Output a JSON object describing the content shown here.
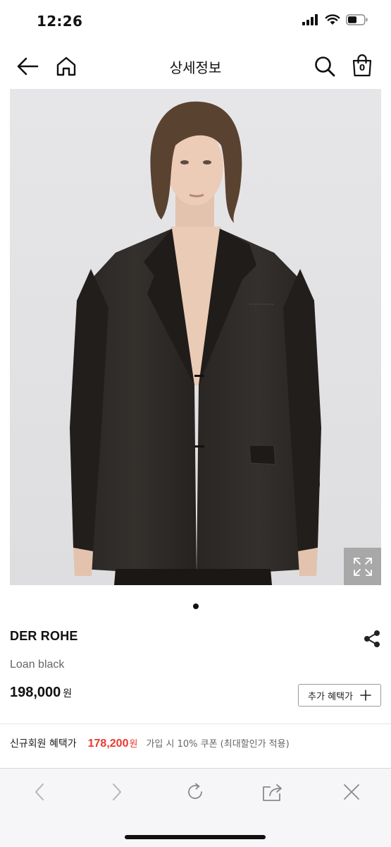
{
  "status_bar": {
    "time": "12:26",
    "battery_icon": "battery-icon",
    "wifi_icon": "wifi-icon",
    "signal_icon": "signal-icon"
  },
  "nav": {
    "title": "상세정보",
    "back_icon": "arrow-left-icon",
    "home_icon": "home-icon",
    "search_icon": "search-icon",
    "cart_icon": "shopping-bag-icon",
    "cart_count": "0"
  },
  "product": {
    "image_alt_icon": "product-photo",
    "zoom_icon": "expand-icon",
    "brand": "DER ROHE",
    "name": "Loan black",
    "price": "198,000",
    "price_unit": "원",
    "benefit_button_label": "추가 혜택가",
    "share_icon": "share-icon"
  },
  "member_benefit": {
    "label": "신규회원 혜택가",
    "price": "178,200",
    "unit": "원",
    "description": "가입 시 10% 쿠폰 (최대할인가 적용)"
  },
  "colors": {
    "accent_red": "#e8392f",
    "toolbar_bg": "#f6f6f8"
  },
  "toolbar": {
    "back_icon": "chevron-left-icon",
    "forward_icon": "chevron-right-icon",
    "reload_icon": "reload-icon",
    "share_icon": "share-out-icon",
    "close_icon": "close-icon"
  }
}
